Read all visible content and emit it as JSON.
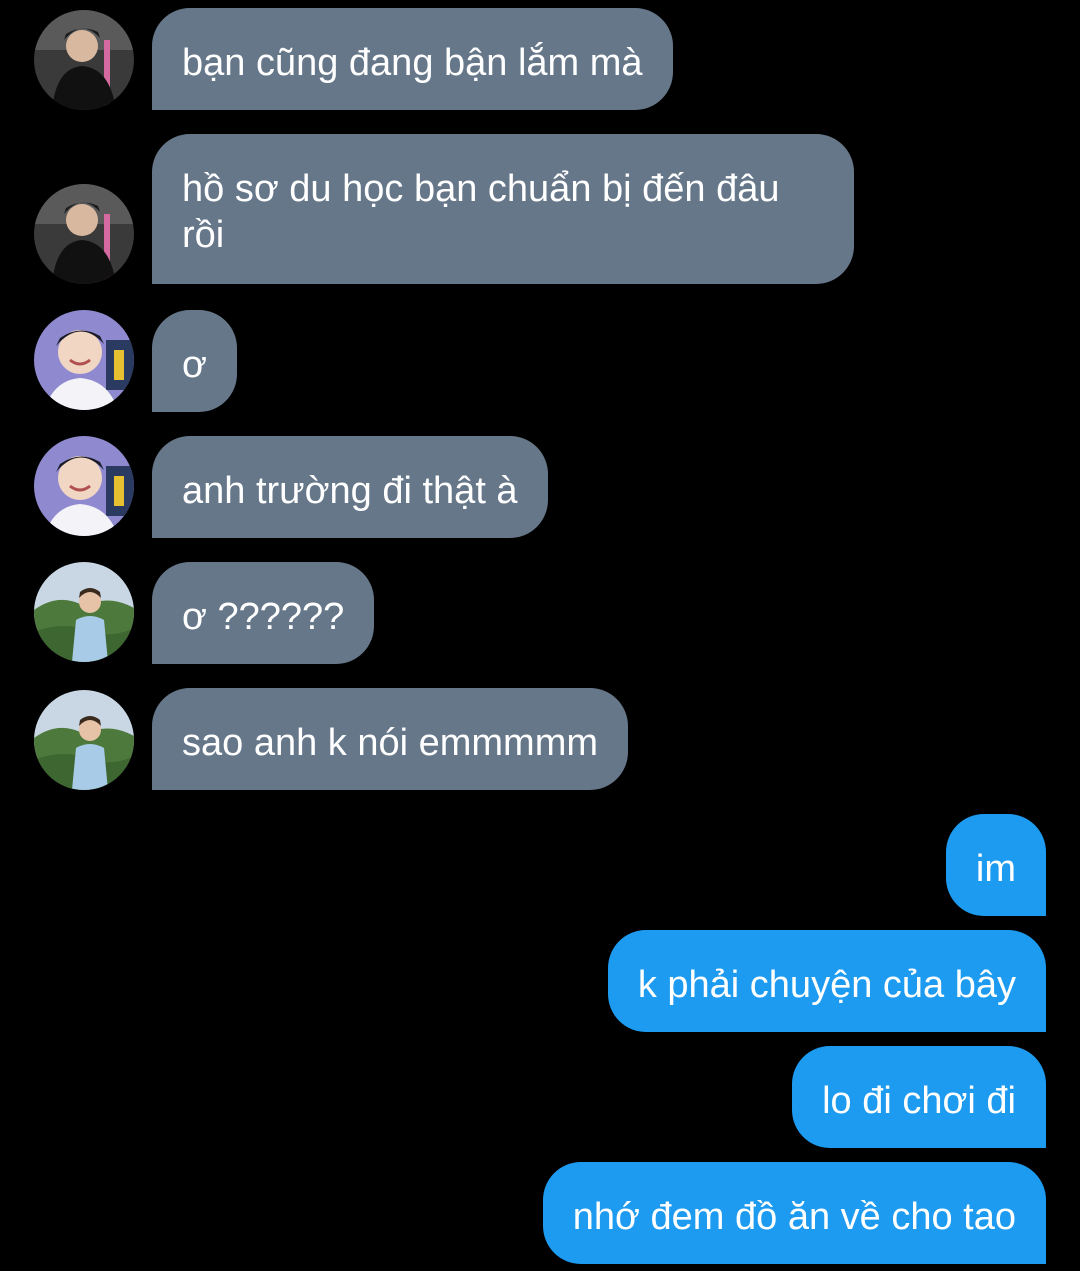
{
  "colors": {
    "background": "#000000",
    "incoming_bubble": "#66778a",
    "outgoing_bubble": "#1d9bf0",
    "text": "#ffffff"
  },
  "messages": [
    {
      "direction": "incoming",
      "sender": "user-a",
      "avatar": "avatar-dark-shirt-icon",
      "text": "bạn cũng đang bận lắm mà"
    },
    {
      "direction": "incoming",
      "sender": "user-a",
      "avatar": "avatar-dark-shirt-icon",
      "text": "hồ sơ du học bạn chuẩn bị đến đâu rồi"
    },
    {
      "direction": "incoming",
      "sender": "user-b",
      "avatar": "avatar-smiling-icon",
      "text": "ơ"
    },
    {
      "direction": "incoming",
      "sender": "user-b",
      "avatar": "avatar-smiling-icon",
      "text": "anh trường đi thật à"
    },
    {
      "direction": "incoming",
      "sender": "user-c",
      "avatar": "avatar-outdoor-icon",
      "text": "ơ ??????"
    },
    {
      "direction": "incoming",
      "sender": "user-c",
      "avatar": "avatar-outdoor-icon",
      "text": "sao anh k nói emmmmm"
    },
    {
      "direction": "outgoing",
      "text": "im"
    },
    {
      "direction": "outgoing",
      "text": "k phải chuyện của bây"
    },
    {
      "direction": "outgoing",
      "text": "lo đi chơi đi"
    },
    {
      "direction": "outgoing",
      "text": "nhớ đem đồ ăn về cho tao"
    }
  ]
}
